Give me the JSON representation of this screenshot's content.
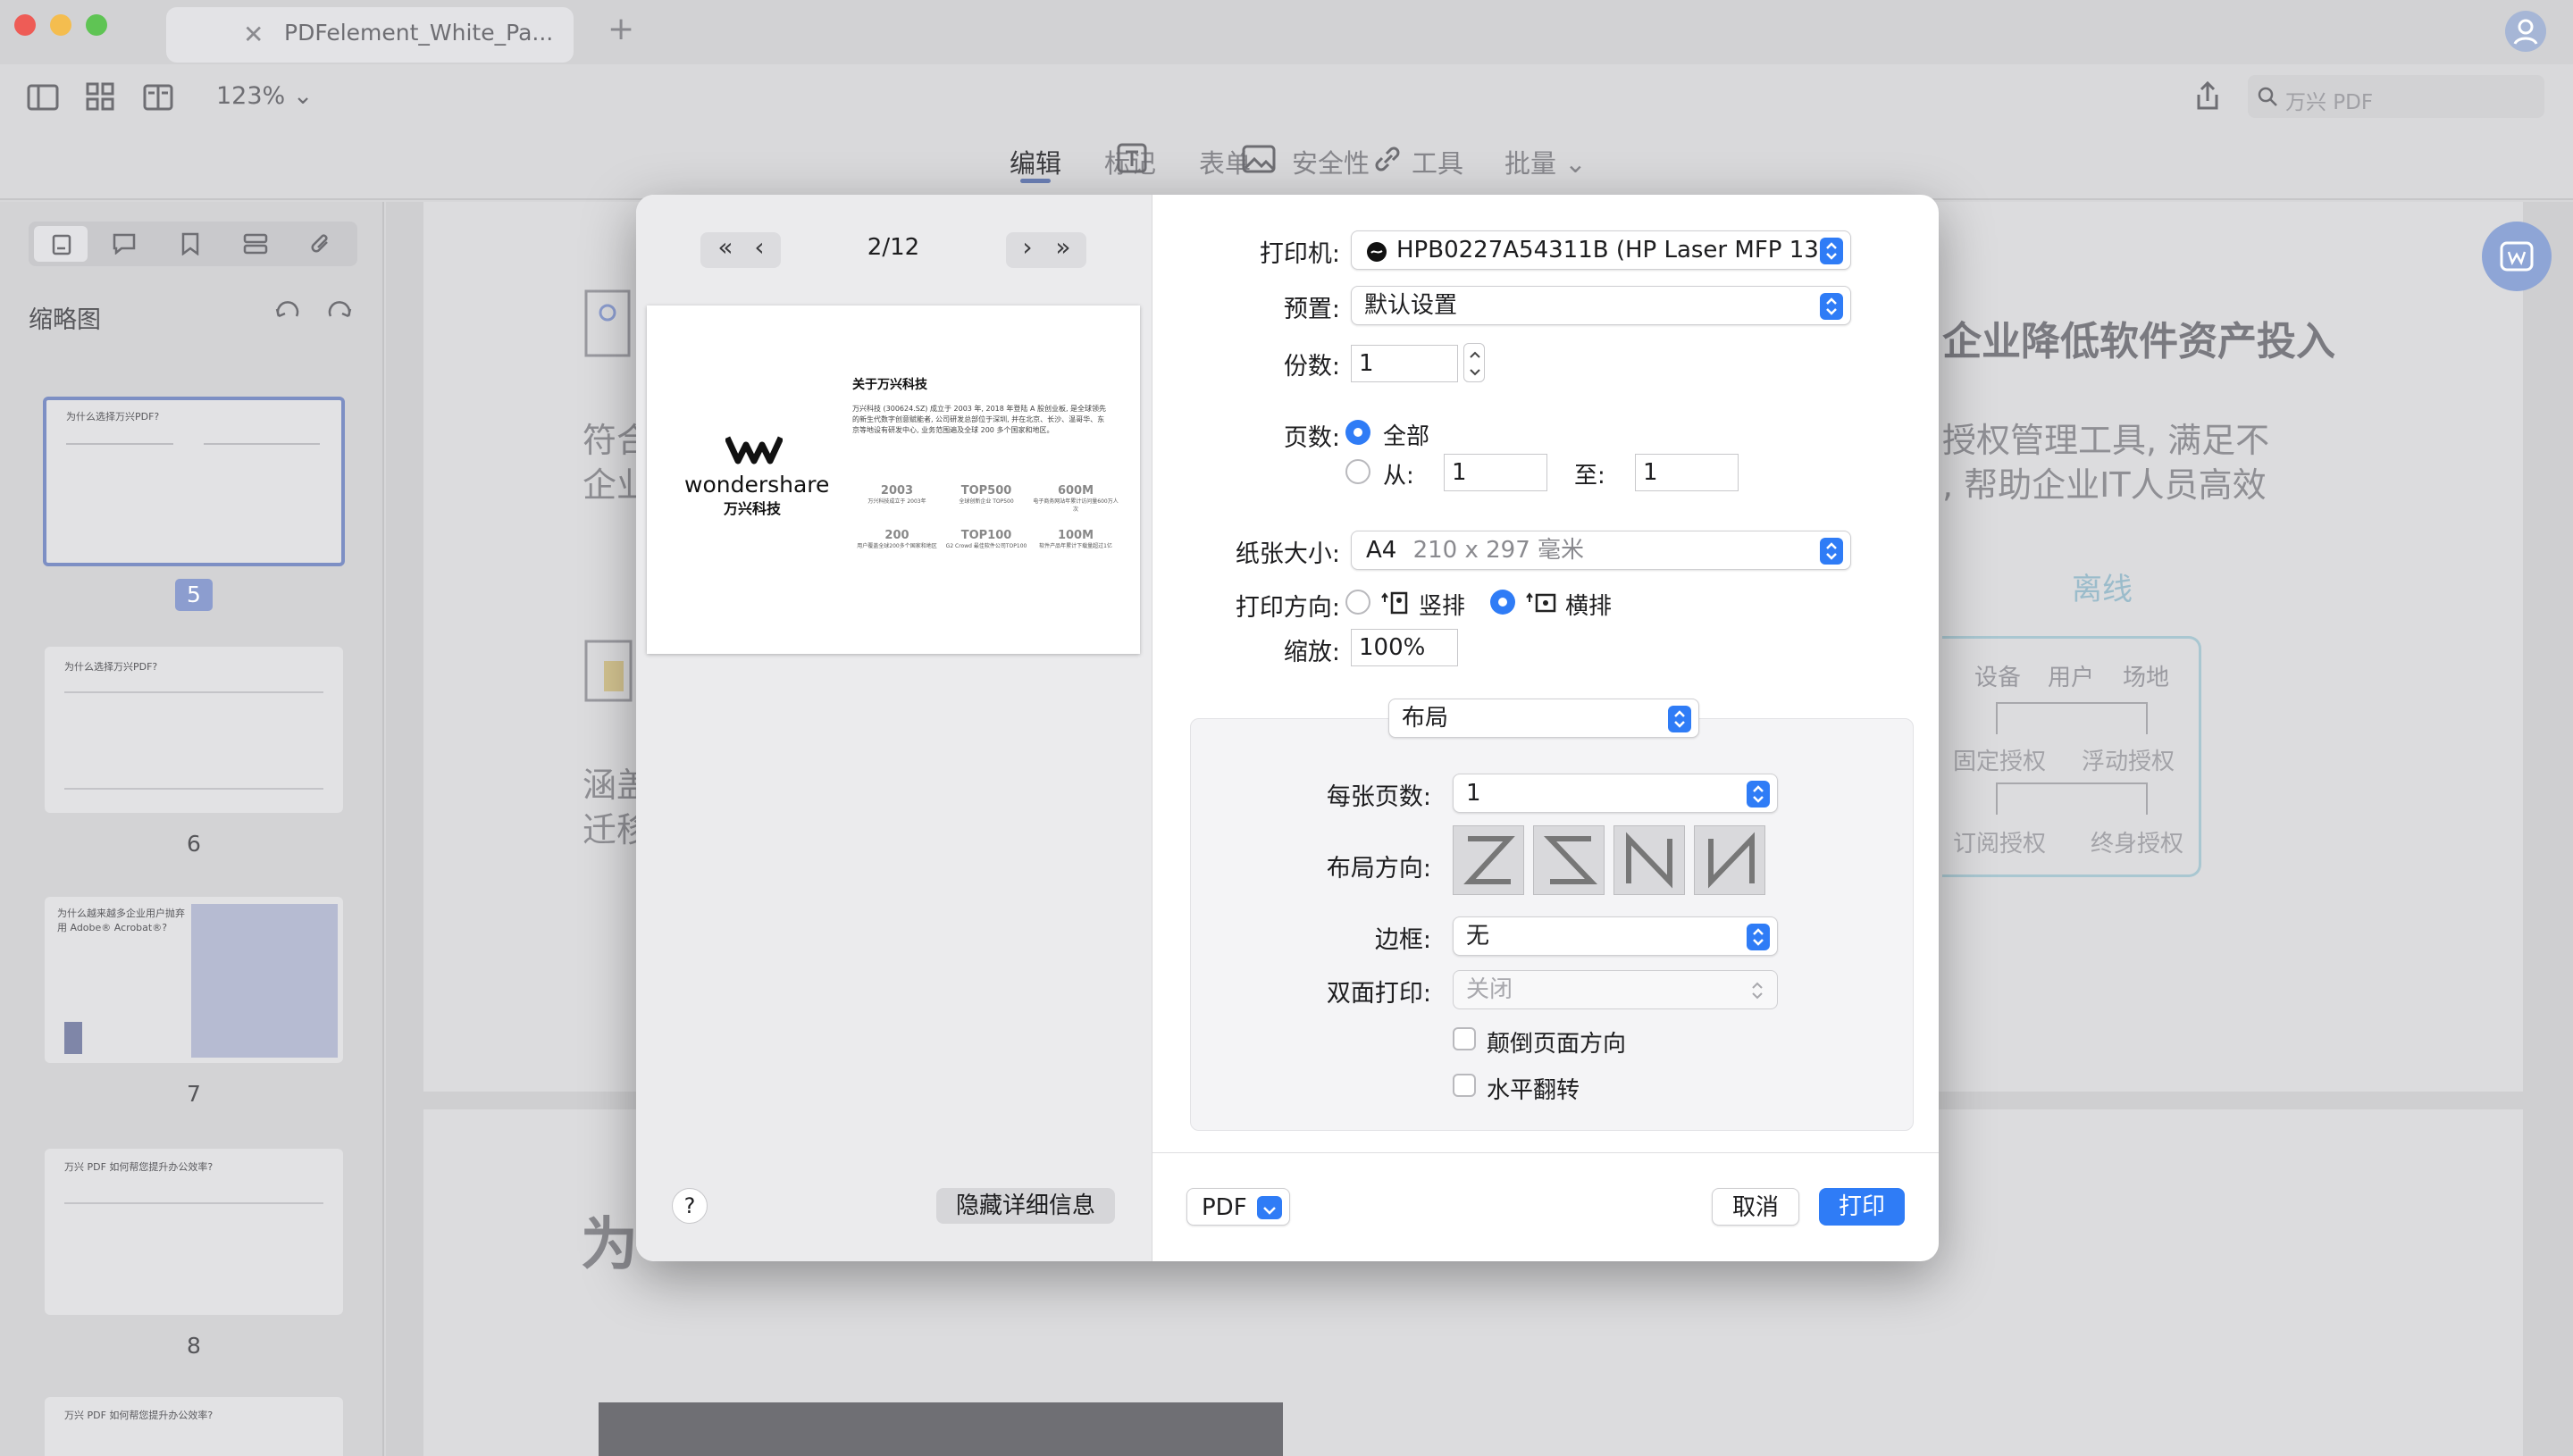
{
  "window": {
    "tab_title": "PDFelement_White_Pa...",
    "zoom": "123%",
    "search_placeholder": "万兴 PDF"
  },
  "toolbar": {
    "nav": [
      "编辑",
      "标记",
      "表单",
      "安全性",
      "工具",
      "批量"
    ],
    "active_nav": "编辑",
    "sub_tools": [
      "文本",
      "图像",
      "链接"
    ]
  },
  "sidebar": {
    "title": "缩略图",
    "thumbnails": [
      {
        "num": "5",
        "selected": true,
        "title": "为什么选择万兴PDF?"
      },
      {
        "num": "6",
        "selected": false,
        "title": "为什么选择万兴PDF?"
      },
      {
        "num": "7",
        "selected": false,
        "title": "为什么越来越多企业用户抛弃用 Adobe® Acrobat®?"
      },
      {
        "num": "8",
        "selected": false,
        "title": "万兴 PDF 如何帮您提升办公效率?"
      },
      {
        "num": "",
        "selected": false,
        "title": "万兴 PDF 如何帮您提升办公效率?"
      }
    ]
  },
  "document": {
    "line1_right": "企业降低软件资产投入",
    "left1a": "符合",
    "left1b": "企业",
    "right1a": "授权管理工具, 满足不",
    "right1b": ", 帮助企业IT人员高效",
    "left2a": "涵盖",
    "left2b": "迁移",
    "diagram": {
      "title": "离线",
      "row1": [
        "设备",
        "用户",
        "场地"
      ],
      "row2": [
        "固定授权",
        "浮动授权"
      ],
      "row3": [
        "订阅授权",
        "终身授权"
      ]
    },
    "bottom_char": "为"
  },
  "print_dialog": {
    "preview": {
      "page_indicator": "2/12",
      "thumb_title": "关于万兴科技",
      "brand": "wondershare",
      "brand_cn": "万兴科技",
      "body": "万兴科技 (300624.SZ) 成立于 2003 年, 2018 年登陆 A 股创业板, 是全球领先的新生代数字创意赋能者, 公司研发总部位于深圳, 并在北京、长沙、温哥华、东京等地设有研发中心, 业务范围遍及全球 200 多个国家和地区。",
      "stats": [
        {
          "big": "2003",
          "small": "万兴科技成立于 2003年"
        },
        {
          "big": "TOP500",
          "small": "全球创新企业 TOP500"
        },
        {
          "big": "600M",
          "small": "电子商务网站年累计访问量600万人次"
        },
        {
          "big": "200",
          "small": "用户覆盖全球200多个国家和地区"
        },
        {
          "big": "TOP100",
          "small": "G2 Crowd 最佳软件公司TOP100"
        },
        {
          "big": "100M",
          "small": "软件产品年累计下载量超过1亿"
        }
      ],
      "help": "?",
      "hide_details": "隐藏详细信息"
    },
    "labels": {
      "printer": "打印机:",
      "preset": "预置:",
      "copies": "份数:",
      "pages": "页数:",
      "paper_size": "纸张大小:",
      "orientation": "打印方向:",
      "scale": "缩放:",
      "pages_per_sheet": "每张页数:",
      "layout_direction": "布局方向:",
      "border": "边框:",
      "two_sided": "双面打印:"
    },
    "values": {
      "printer": "HPB0227A54311B (HP Laser MFP 13...",
      "preset": "默认设置",
      "copies": "1",
      "pages_all": "全部",
      "pages_from": "从:",
      "from_value": "1",
      "pages_to": "至:",
      "to_value": "1",
      "paper_size": "A4",
      "paper_dims": "210 x 297 毫米",
      "portrait": "竖排",
      "landscape": "横排",
      "scale": "100%",
      "section": "布局",
      "pages_per_sheet": "1",
      "border": "无",
      "two_sided": "关闭",
      "reverse_orientation": "颠倒页面方向",
      "flip_horizontal": "水平翻转"
    },
    "footer": {
      "pdf": "PDF",
      "cancel": "取消",
      "print": "打印"
    },
    "accent": "#2f7cf6"
  }
}
